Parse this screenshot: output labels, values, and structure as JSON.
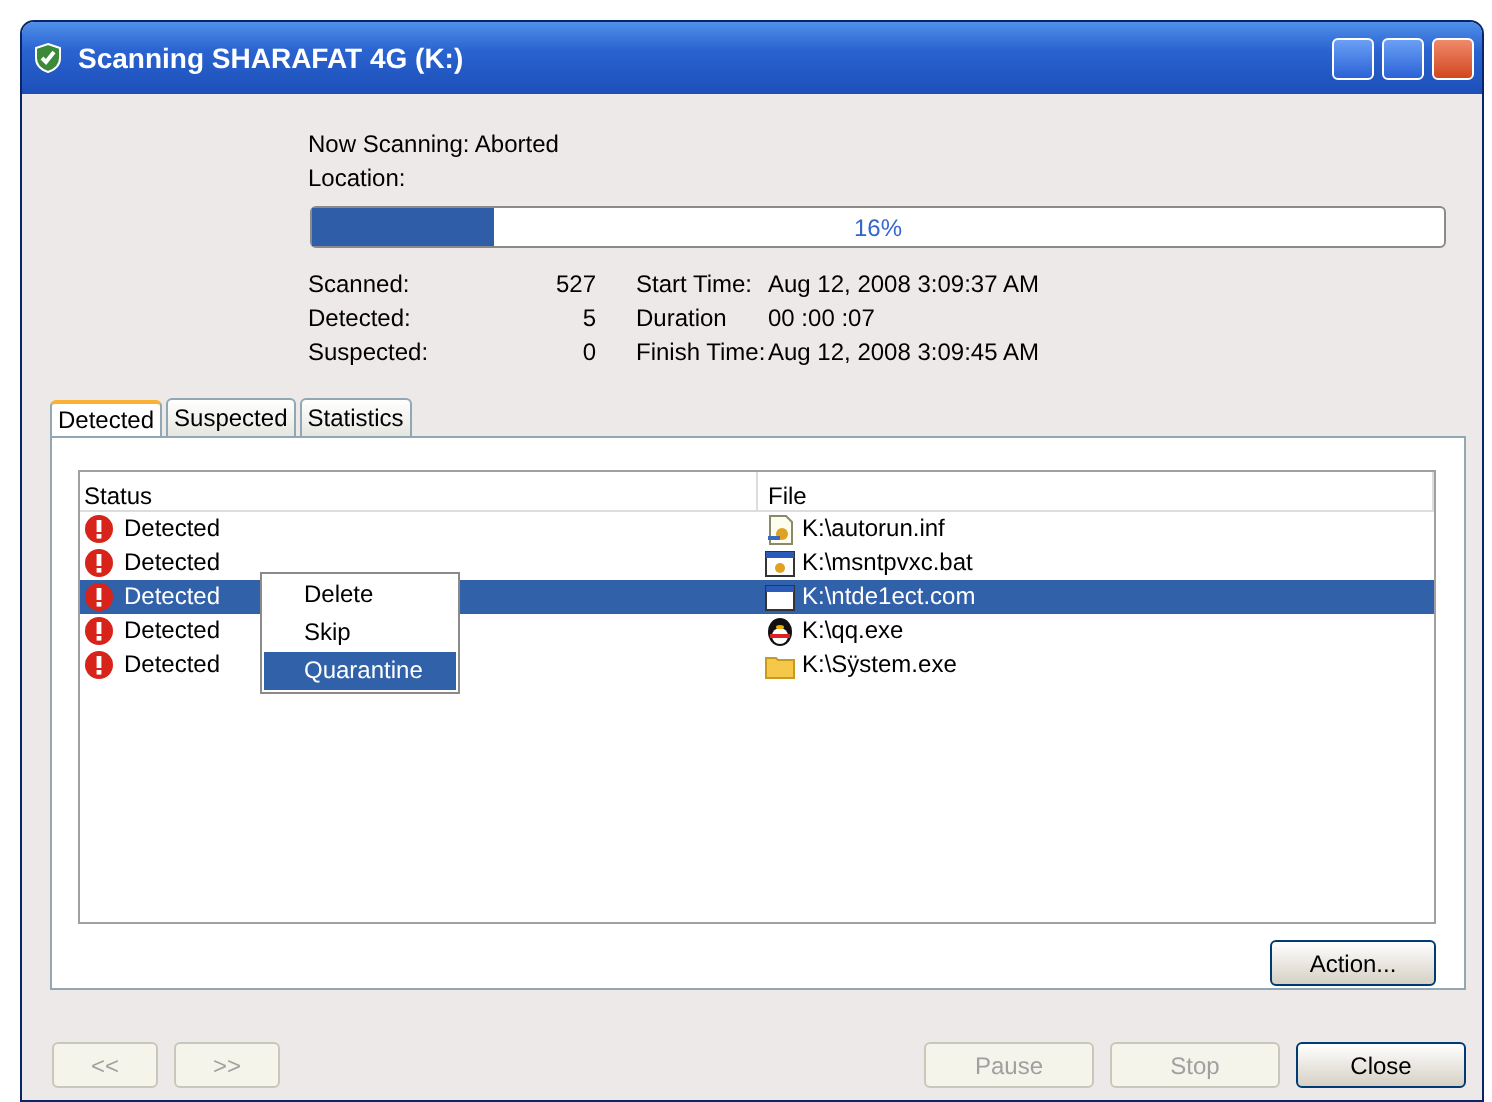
{
  "window": {
    "title": "Scanning SHARAFAT 4G (K:)"
  },
  "scan_info": {
    "now_scanning_label": "Now Scanning:",
    "now_scanning_value": "Aborted",
    "location_label": "Location:"
  },
  "progress": {
    "level": 0.16,
    "reading": "16%"
  },
  "stats_left": [
    {
      "label": "Scanned:",
      "value": "527"
    },
    {
      "label": "Detected:",
      "value": "5"
    },
    {
      "label": "Suspected:",
      "value": "0"
    }
  ],
  "stats_right": [
    {
      "label": "Start Time:",
      "value": "Aug 12, 2008 3:09:37 AM"
    },
    {
      "label": "Duration",
      "value": "00 :00 :07"
    },
    {
      "label": "Finish Time:",
      "value": "Aug 12, 2008 3:09:45 AM"
    }
  ],
  "tabs": [
    {
      "label": "Detected",
      "selected": true
    },
    {
      "label": "Suspected",
      "selected": false
    },
    {
      "label": "Statistics",
      "selected": false
    }
  ],
  "table": {
    "columns": [
      "Status",
      "File"
    ],
    "rows": [
      {
        "status": "Detected",
        "file": "K:\\autorun.inf",
        "kind": "script",
        "selected": false
      },
      {
        "status": "Detected",
        "file": "K:\\msntpvxc.bat",
        "kind": "batch",
        "selected": false
      },
      {
        "status": "Detected",
        "file": "K:\\ntde1ect.com",
        "kind": "window",
        "selected": true
      },
      {
        "status": "Detected",
        "file": "K:\\qq.exe",
        "kind": "app",
        "selected": false
      },
      {
        "status": "Detected",
        "file": "K:\\Sÿstem.exe",
        "kind": "folder",
        "selected": false
      }
    ]
  },
  "context_menu": [
    {
      "label": "Delete",
      "selected": false
    },
    {
      "label": "Skip",
      "selected": false
    },
    {
      "label": "Quarantine",
      "selected": true
    }
  ],
  "action_button": "Action...",
  "nav_buttons": [
    {
      "label": "<<",
      "disabled": true
    },
    {
      "label": ">>",
      "disabled": true
    }
  ],
  "buttons": [
    {
      "label": "Pause",
      "disabled": true
    },
    {
      "label": "Stop",
      "disabled": true
    },
    {
      "label": "Close",
      "disabled": false
    }
  ]
}
